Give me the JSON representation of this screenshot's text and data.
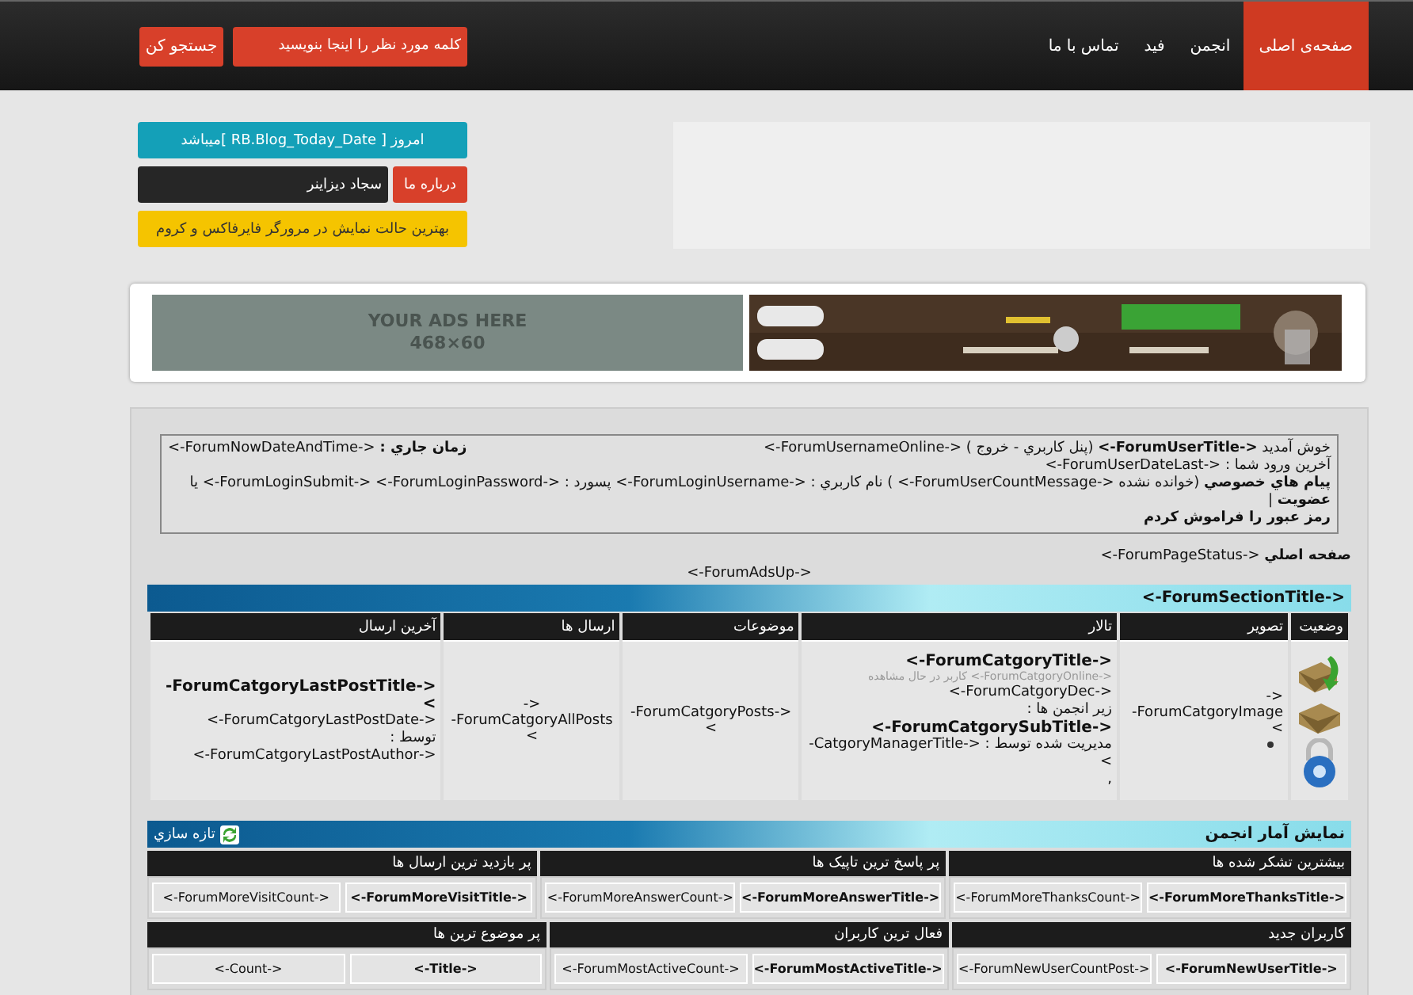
{
  "nav": {
    "items": [
      {
        "label": "صفحه‌ی اصلی",
        "selected": true
      },
      {
        "label": "انجمن",
        "selected": false
      },
      {
        "label": "فید",
        "selected": false
      },
      {
        "label": "تماس با ما",
        "selected": false
      }
    ],
    "search_placeholder": "کلمه مورد نظر را اینجا بنویسید",
    "search_button": "جستجو کن"
  },
  "widgets": {
    "date": "امروز [ RB.Blog_Today_Date ]میباشد",
    "about_label": "درباره ما",
    "about_name": "سجاد دیزاینر",
    "notice": "بهترین حالت نمایش در مرورگر فایرفاکس و کروم"
  },
  "ads": {
    "placeholder_lines": [
      "YOUR ADS HERE",
      "468×60"
    ]
  },
  "login": {
    "welcome": "خوش آمدید **<-ForumUserTitle->** (پنل کاربري - خروج ) <-ForumUsernameOnline->",
    "time_label": "زمان جاري :",
    "time_value": "<-ForumNowDateAndTime->",
    "last_login": "آخرین ورود شما : <-ForumUserDateLast->",
    "messages": "**پیام هاي خصوصي** (خوانده نشده <-ForumUserCountMessage-> ) نام کاربري : <-ForumLoginUsername-> پسورد : <-ForumLoginSubmit-> <-ForumLoginPassword-> یا **عضویت** |",
    "forgot": "رمز عبور را فراموش کردم"
  },
  "page_status": "**صفحه اصلي** <-ForumPageStatus->",
  "ads_up": "<-ForumAdsUp->",
  "section_title": "<-ForumSectionTitle->",
  "table": {
    "columns": [
      "وضعیت",
      "تصویر",
      "تالار",
      "موضوعات",
      "ارسال ها",
      "آخرین ارسال"
    ],
    "row": {
      "image": "<-ForumCatgoryImage->",
      "title": "<-ForumCatgoryTitle->",
      "online": "<-ForumCatgoryOnline-> کاربر در حال مشاهده",
      "description": "<-ForumCatgoryDec->",
      "sub_label": "زیر انجمن ها :",
      "sub_title": "<-ForumCatgorySubTitle->",
      "manager": "مدیریت شده توسط : <-CatgoryManagerTitle->",
      "separator": ",",
      "topics": "<-ForumCatgoryPosts->",
      "posts": "<-ForumCatgoryAllPosts->",
      "last_title": "<-ForumCatgoryLastPostTitle->",
      "last_date": "<-ForumCatgoryLastPostDate->",
      "last_by": "توسط :",
      "last_author": "<-ForumCatgoryLastPostAuthor->"
    }
  },
  "stats": {
    "title": "نمایش آمار انجمن",
    "refresh": "تازه سازي",
    "groups": [
      {
        "heading": "بیشترین تشکر شده ها",
        "title": "<-ForumMoreThanksTitle->",
        "count": "<-ForumMoreThanksCount->"
      },
      {
        "heading": "پر پاسخ ترین تاپیک ها",
        "title": "<-ForumMoreAnswerTitle->",
        "count": "<-ForumMoreAnswerCount->"
      },
      {
        "heading": "پر بازدید ترین ارسال ها",
        "title": "<-ForumMoreVisitTitle->",
        "count": "<-ForumMoreVisitCount->"
      },
      {
        "heading": "کاربران جدید",
        "title": "<-ForumNewUserTitle->",
        "count": "<-ForumNewUserCountPost->"
      },
      {
        "heading": "فعال ترین کاربران",
        "title": "<-ForumMostActiveTitle->",
        "count": "<-ForumMostActiveCount->"
      },
      {
        "heading": "پر موضوع ترین ها",
        "title": "<-Title->",
        "count": "<-Count->"
      }
    ]
  }
}
